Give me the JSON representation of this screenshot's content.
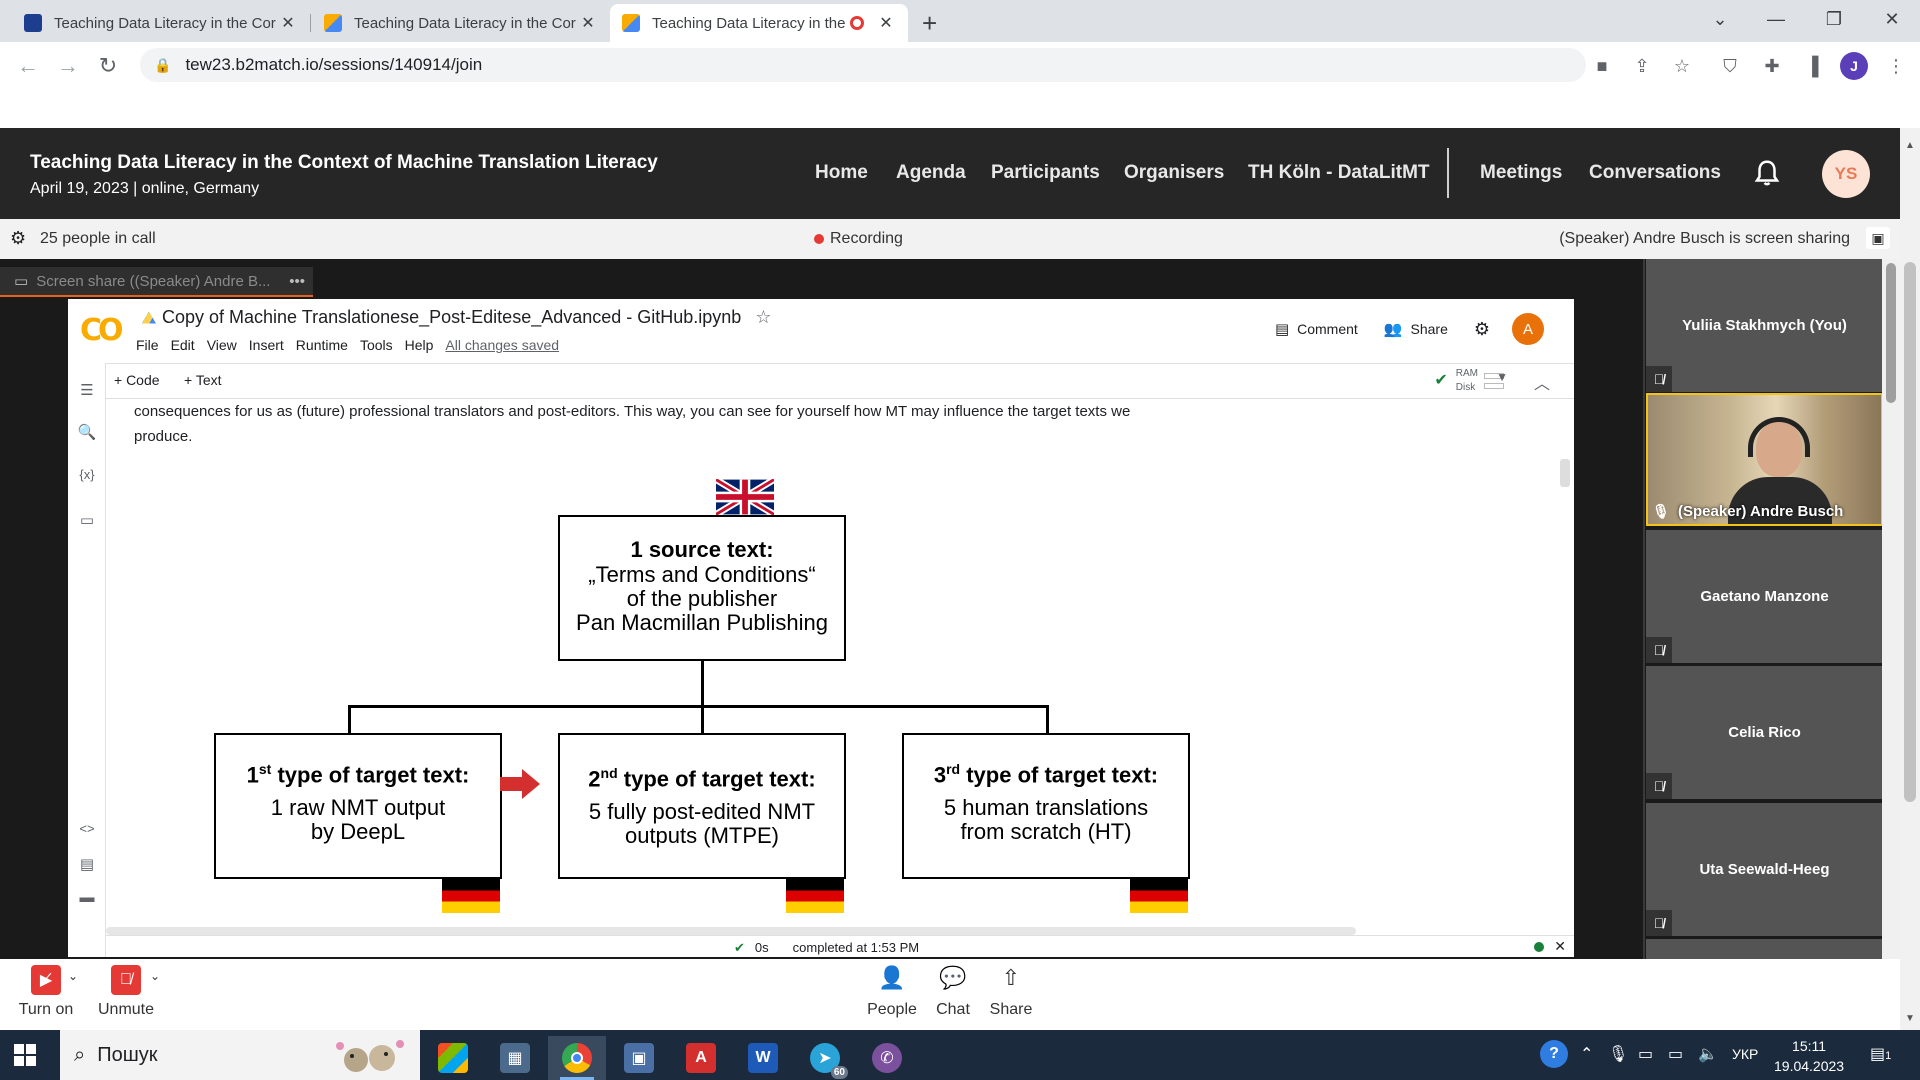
{
  "browser": {
    "tabs": [
      {
        "title": "Teaching Data Literacy in the Cor",
        "active": false
      },
      {
        "title": "Teaching Data Literacy in the Cor",
        "active": false
      },
      {
        "title": "Teaching Data Literacy in the",
        "active": true
      }
    ],
    "new_tab": "+",
    "url": "tew23.b2match.io/sessions/140914/join",
    "profile_initial": "J"
  },
  "site": {
    "event_title": "Teaching Data Literacy in the Context of Machine Translation Literacy",
    "event_subtitle": "April 19, 2023 | online, Germany",
    "nav": [
      "Home",
      "Agenda",
      "Participants",
      "Organisers",
      "TH Köln - DataLitMT",
      "Meetings",
      "Conversations"
    ],
    "user_initials": "YS"
  },
  "call": {
    "people_in_call": "25 people in call",
    "recording": "Recording",
    "sharing_status": "(Speaker) Andre Busch is screen sharing",
    "share_tab_label": "Screen share ((Speaker) Andre B...",
    "share_tab_more": "•••"
  },
  "participants": [
    {
      "name": "Yuliia Stakhmych (You)"
    },
    {
      "name": "(Speaker) Andre Busch"
    },
    {
      "name": "Gaetano Manzone"
    },
    {
      "name": "Celia Rico"
    },
    {
      "name": "Uta Seewald-Heeg"
    }
  ],
  "colab": {
    "logo": "CO",
    "notebook_title": "Copy of Machine Translationese_Post-Editese_Advanced - GitHub.ipynb",
    "menu": [
      "File",
      "Edit",
      "View",
      "Insert",
      "Runtime",
      "Tools",
      "Help"
    ],
    "saved_status": "All changes saved",
    "comment": "Comment",
    "share": "Share",
    "avatar_initial": "A",
    "add_code": "+ Code",
    "add_text": "+ Text",
    "ram": "RAM",
    "disk": "Disk",
    "cell_text": "consequences for us as (future) professional translators and post-editors. This way, you can see for yourself how MT may influence the target texts we produce.",
    "diagram": {
      "source_head": "1 source text:",
      "source_lines": [
        "„Terms and Conditions“",
        "of the publisher",
        "Pan Macmillan Publishing"
      ],
      "targets": [
        {
          "ord": "1",
          "sup": "st",
          "head": " type of target text:",
          "lines": [
            "1 raw NMT output",
            "by DeepL"
          ]
        },
        {
          "ord": "2",
          "sup": "nd",
          "head": " type of target text:",
          "lines": [
            "5 fully post-edited NMT",
            "outputs (MTPE)"
          ]
        },
        {
          "ord": "3",
          "sup": "rd",
          "head": " type of target text:",
          "lines": [
            "5 human translations",
            "from scratch (HT)"
          ]
        }
      ]
    },
    "exec_time": "0s",
    "completed": "completed at 1:53 PM"
  },
  "controls": {
    "camera": "Turn on",
    "mic": "Unmute",
    "people": "People",
    "chat": "Chat",
    "share": "Share"
  },
  "taskbar": {
    "search": "Пошук",
    "lang": "УКР",
    "time": "15:11",
    "date": "19.04.2023",
    "notif_count": "1",
    "telegram_badge": "60"
  }
}
